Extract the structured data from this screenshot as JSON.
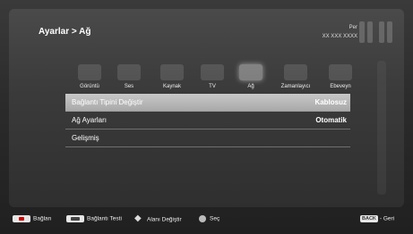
{
  "header": {
    "breadcrumb": "Ayarlar > Ağ",
    "day": "Per",
    "date": "XX XXX XXXX"
  },
  "tabs": [
    {
      "label": "Görüntü",
      "icon": "picture-icon"
    },
    {
      "label": "Ses",
      "icon": "sound-icon"
    },
    {
      "label": "Kaynak",
      "icon": "source-icon"
    },
    {
      "label": "TV",
      "icon": "tv-icon"
    },
    {
      "label": "Ağ",
      "icon": "network-icon"
    },
    {
      "label": "Zamanlayıcı",
      "icon": "timer-icon"
    },
    {
      "label": "Ebeveyn",
      "icon": "parental-icon"
    }
  ],
  "menu": [
    {
      "label": "Bağlantı Tipini Değiştir",
      "value": "Kablosuz"
    },
    {
      "label": "Ağ Ayarları",
      "value": "Otomatik"
    },
    {
      "label": "Gelişmiş",
      "value": ""
    }
  ],
  "footer": {
    "connect": "Bağlan",
    "connection_test": "Bağlantı Testi",
    "change_area": "Alanı Değiştir",
    "select": "Seç",
    "back_key": "BACK",
    "back": "- Geri"
  }
}
